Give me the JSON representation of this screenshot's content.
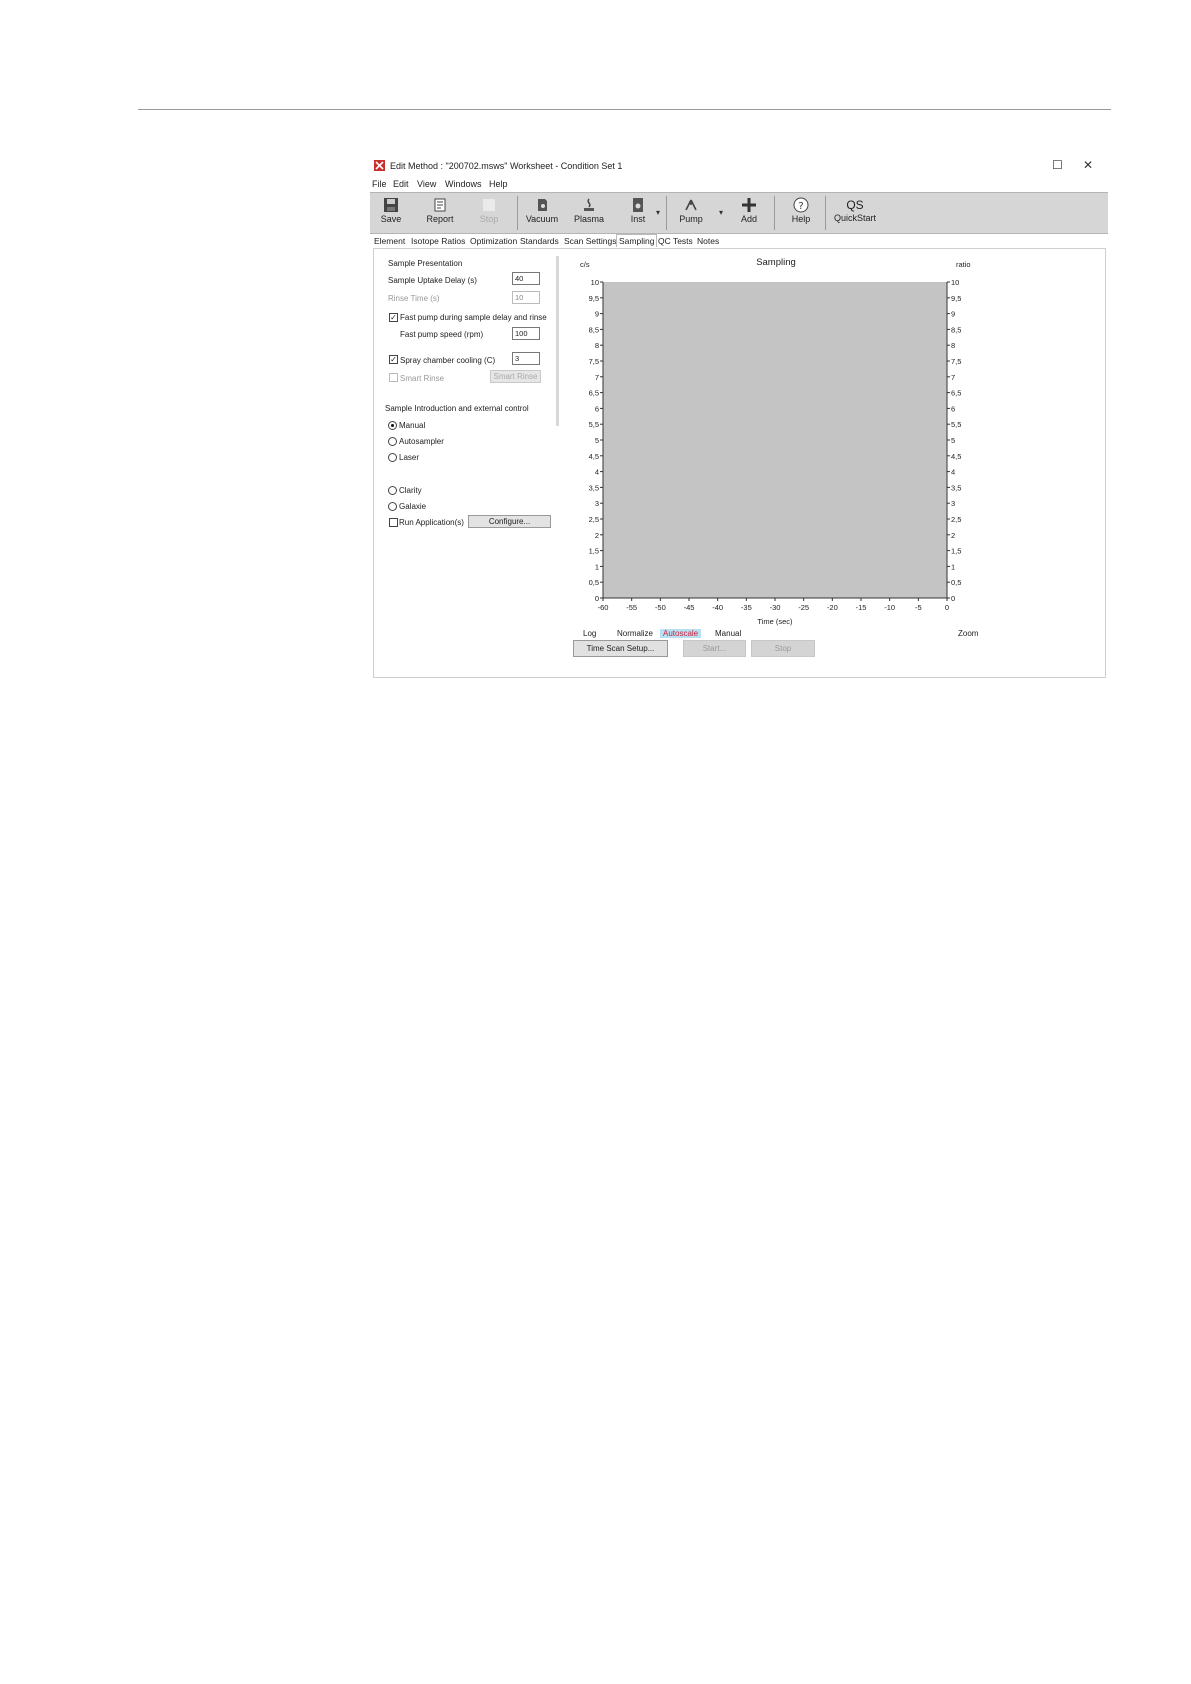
{
  "window": {
    "title": "Edit Method : \"200702.msws\" Worksheet - Condition Set 1",
    "maximize_glyph": "☐",
    "close_glyph": "✕"
  },
  "menu": [
    "File",
    "Edit",
    "View",
    "Windows",
    "Help"
  ],
  "toolbar": {
    "save": "Save",
    "report": "Report",
    "stop": "Stop",
    "vacuum": "Vacuum",
    "plasma": "Plasma",
    "inst": "Inst",
    "pump": "Pump",
    "add": "Add",
    "help": "Help",
    "quickstart_glyph": "QS",
    "quickstart": "QuickStart",
    "dropdown_glyph": "▾"
  },
  "tabs": [
    "Element",
    "Isotope Ratios",
    "Optimization",
    "Standards",
    "Scan Settings",
    "Sampling",
    "QC Tests",
    "Notes"
  ],
  "active_tab": "Sampling",
  "left_panel": {
    "sample_presentation": {
      "heading": "Sample Presentation",
      "uptake_label": "Sample Uptake Delay (s)",
      "uptake_value": "40",
      "rinse_label": "Rinse Time (s)",
      "rinse_value": "10",
      "fast_pump_label": "Fast pump during sample delay and rinse",
      "fast_pump_checked": true,
      "fast_pump_speed_label": "Fast pump speed (rpm)",
      "fast_pump_speed_value": "100",
      "spray_label": "Spray chamber cooling (C)",
      "spray_checked": true,
      "spray_value": "3",
      "smart_rinse_label": "Smart Rinse",
      "smart_rinse_button": "Smart Rinse",
      "check_glyph": "✓"
    },
    "sample_introduction": {
      "heading": "Sample Introduction and external control",
      "options": [
        "Manual",
        "Autosampler",
        "Laser"
      ],
      "options2": [
        "Clarity",
        "Galaxie"
      ],
      "selected": "Manual",
      "run_app_label": "Run Application(s)",
      "configure_button": "Configure..."
    }
  },
  "chart_data": {
    "type": "line",
    "title": "Sampling",
    "y_left_label": "c/s",
    "y_right_label": "ratio",
    "xlabel": "Time (sec)",
    "xlim": [
      -60,
      0
    ],
    "ylim": [
      0,
      10
    ],
    "x_ticks": [
      "-60",
      "-55",
      "-50",
      "-45",
      "-40",
      "-35",
      "-30",
      "-25",
      "-20",
      "-15",
      "-10",
      "-5",
      "0"
    ],
    "y_left_ticks": [
      "0",
      "0,5",
      "1",
      "1,5",
      "2",
      "2,5",
      "3",
      "3,5",
      "4",
      "4,5",
      "5",
      "5,5",
      "6",
      "6,5",
      "7",
      "7,5",
      "8",
      "8,5",
      "9",
      "9,5",
      "10"
    ],
    "y_right_ticks": [
      "0",
      "0,5",
      "1",
      "1,5",
      "2",
      "2,5",
      "3",
      "3,5",
      "4",
      "4,5",
      "5",
      "5,5",
      "6",
      "6,5",
      "7",
      "7,5",
      "8",
      "8,5",
      "9",
      "9,5",
      "10"
    ],
    "series": [],
    "plot_background": "#c4c4c4"
  },
  "graph_options": {
    "log": "Log",
    "normalize": "Normalize",
    "autoscale": "Autoscale",
    "manual": "Manual",
    "zoom": "Zoom",
    "active": "Autoscale"
  },
  "bottom_buttons": {
    "time_scan_setup": "Time Scan Setup...",
    "start": "Start...",
    "stop": "Stop"
  },
  "colors": {
    "toolbar_bg": "#d6d6d6",
    "active_option_bg": "#b9dff2",
    "active_option_text": "#d0213a",
    "logo": "#c9302c"
  }
}
